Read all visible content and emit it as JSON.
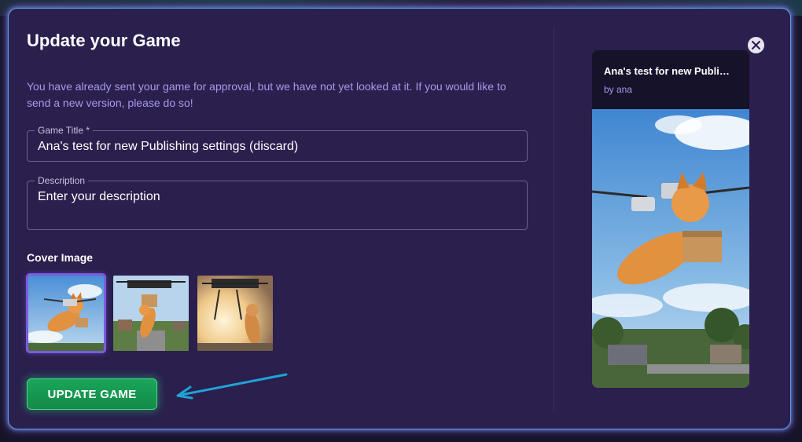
{
  "dialog": {
    "title": "Update your Game",
    "notice": "You have already sent your game for approval, but we have not yet looked at it. If you would like to send a new version, please do so!"
  },
  "form": {
    "game_title": {
      "label": "Game Title *",
      "value": "Ana's test for new Publishing settings (discard)"
    },
    "description": {
      "label": "Description",
      "placeholder": "Enter your description"
    },
    "cover_image": {
      "label": "Cover Image",
      "options": [
        {
          "name": "cat-drone-flying",
          "selected": true
        },
        {
          "name": "cat-reaching-drone-street",
          "selected": false
        },
        {
          "name": "cat-standing-drone-sunset",
          "selected": false
        }
      ]
    },
    "submit_label": "UPDATE GAME"
  },
  "preview": {
    "title": "Ana's test for new Publi…",
    "author": "by ana"
  },
  "icons": {
    "close": "close-icon",
    "arrow": "arrow-left-icon"
  },
  "colors": {
    "modal_bg": "#2a1f4d",
    "accent_purple": "#7d5be0",
    "button_green": "#1aa55a",
    "notice_text": "#a79ae8",
    "arrow": "#1fa3d6"
  }
}
